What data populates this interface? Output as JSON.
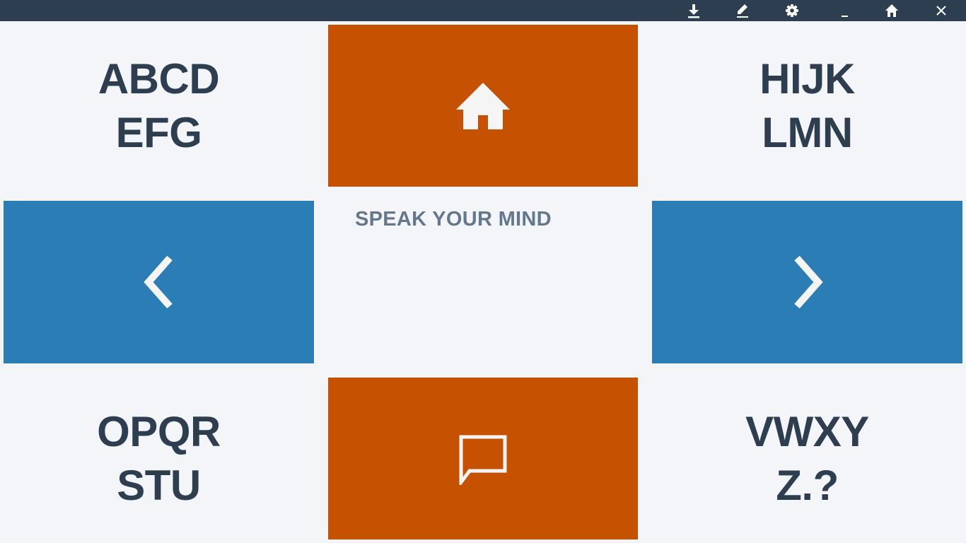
{
  "titlebar": {
    "buttons": [
      {
        "name": "download",
        "icon": "download-icon"
      },
      {
        "name": "edit",
        "icon": "pencil-icon"
      },
      {
        "name": "settings",
        "icon": "gear-icon"
      },
      {
        "name": "minimize",
        "icon": "minimize-icon"
      },
      {
        "name": "home",
        "icon": "home-icon"
      },
      {
        "name": "close",
        "icon": "close-icon"
      }
    ]
  },
  "tiles": {
    "top_left": {
      "line1": "ABCD",
      "line2": "EFG"
    },
    "top_right": {
      "line1": "HIJK",
      "line2": "LMN"
    },
    "bottom_left": {
      "line1": "OPQR",
      "line2": "STU"
    },
    "bottom_right": {
      "line1": "VWXY",
      "line2": "Z.?"
    },
    "top_center_icon": "home-icon",
    "bottom_center_icon": "speech-bubble-icon",
    "left_icon": "chevron-left-icon",
    "right_icon": "chevron-right-icon"
  },
  "center": {
    "label": "SPEAK YOUR MIND"
  },
  "colors": {
    "titlebar": "#2d3e50",
    "background": "#f3f5f8",
    "orange_tile": "#c65100",
    "blue_tile": "#2a7db5",
    "letters": "#2d3e50",
    "center_label": "#63788e"
  }
}
